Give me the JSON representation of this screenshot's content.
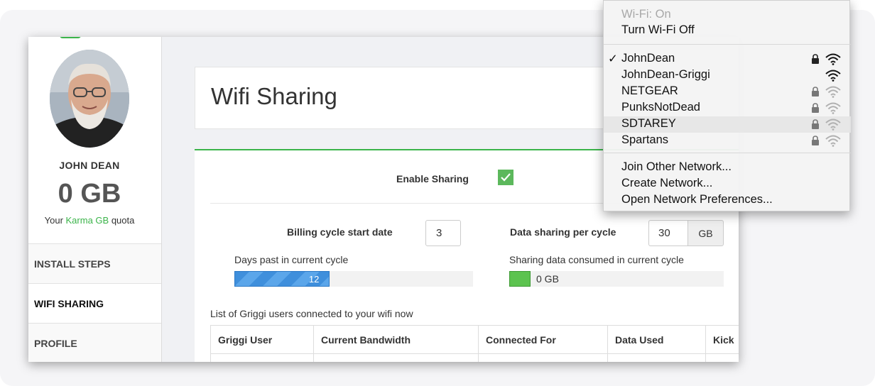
{
  "sidebar": {
    "user_name": "JOHN DEAN",
    "quota_value": "0 GB",
    "quota_prefix": "Your ",
    "quota_brand": "Karma GB",
    "quota_suffix": " quota",
    "items": [
      {
        "label": "INSTALL STEPS",
        "active": false
      },
      {
        "label": "WIFI SHARING",
        "active": true
      },
      {
        "label": "PROFILE",
        "active": false
      }
    ]
  },
  "header": {
    "title": "Wifi Sharing"
  },
  "sharing": {
    "enable_label": "Enable Sharing",
    "enabled": true,
    "billing_label": "Billing cycle start date",
    "billing_value": "3",
    "days_label": "Days past in current cycle",
    "days_value": "12",
    "days_fraction": 0.4,
    "share_label": "Data sharing per cycle",
    "share_value": "30",
    "share_unit": "GB",
    "consumed_label": "Sharing data consumed in current cycle",
    "consumed_value": "0 GB"
  },
  "users": {
    "caption": "List of Griggi users connected to your wifi now",
    "columns": [
      "Griggi User",
      "Current Bandwidth",
      "Connected For",
      "Data Used",
      "Kick"
    ]
  },
  "wifi_menu": {
    "status": "Wi-Fi: On",
    "toggle": "Turn Wi-Fi Off",
    "networks": [
      {
        "name": "JohnDean",
        "selected": true,
        "locked": true,
        "strength": "full"
      },
      {
        "name": "JohnDean-Griggi",
        "selected": false,
        "locked": false,
        "strength": "full"
      },
      {
        "name": "NETGEAR",
        "selected": false,
        "locked": true,
        "strength": "weak"
      },
      {
        "name": "PunksNotDead",
        "selected": false,
        "locked": true,
        "strength": "weak"
      },
      {
        "name": "SDTAREY",
        "selected": false,
        "locked": true,
        "strength": "weak"
      },
      {
        "name": "Spartans",
        "selected": false,
        "locked": true,
        "strength": "weak"
      }
    ],
    "actions": [
      "Join Other Network...",
      "Create Network...",
      "Open Network Preferences..."
    ],
    "check_glyph": "✓"
  },
  "colors": {
    "brand_green": "#3bb44a",
    "progress_blue": "#3f8fdc",
    "checkbox_green": "#5cb85c"
  }
}
